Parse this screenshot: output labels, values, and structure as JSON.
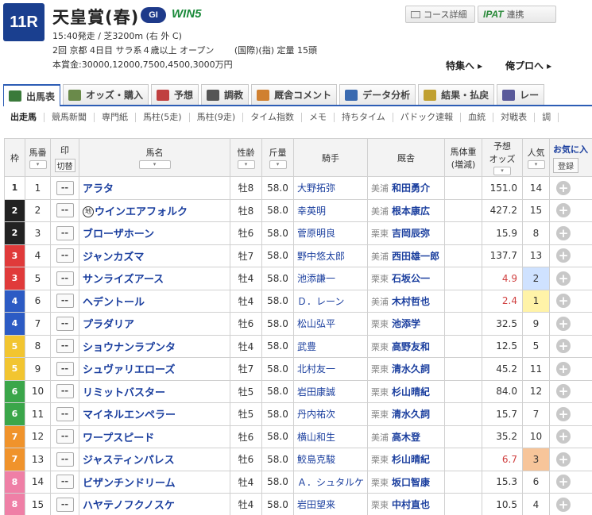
{
  "header": {
    "race_no": "11R",
    "race_name": "天皇賞(春)",
    "grade": "GI",
    "win5": "WIN5",
    "info1": "15:40発走 / 芝3200m (右 外 C)",
    "info2": "2回 京都 4日目 サラ系４歳以上 オープン 　　(国際)(指) 定量 15頭",
    "info3": "本賞金:30000,12000,7500,4500,3000万円",
    "course_detail": "コース詳細",
    "ipat_logo": "IPAT",
    "ipat_label": "連携",
    "tokushu": "特集へ ▸",
    "ore_pro": "俺プロへ ▸"
  },
  "tabs": [
    {
      "label": "出馬表",
      "icon": "table-icon",
      "active": true,
      "color": "#3a7a3a"
    },
    {
      "label": "オッズ・購入",
      "icon": "odds-icon",
      "active": false,
      "color": "#6a8a4a"
    },
    {
      "label": "予想",
      "icon": "target-icon",
      "active": false,
      "color": "#c04040"
    },
    {
      "label": "調教",
      "icon": "stopwatch-icon",
      "active": false,
      "color": "#555555"
    },
    {
      "label": "厩舎コメント",
      "icon": "stable-icon",
      "active": false,
      "color": "#d08030"
    },
    {
      "label": "データ分析",
      "icon": "bar-chart-icon",
      "active": false,
      "color": "#3a6ab0"
    },
    {
      "label": "結果・払戻",
      "icon": "coins-icon",
      "active": false,
      "color": "#c0a030"
    },
    {
      "label": "レー",
      "icon": "video-icon",
      "active": false,
      "color": "#5a5a9a"
    }
  ],
  "subnav": [
    "出走馬",
    "競馬新聞",
    "専門紙",
    "馬柱(5走)",
    "馬柱(9走)",
    "タイム指数",
    "メモ",
    "持ちタイム",
    "パドック速報",
    "血統",
    "対戦表",
    "調"
  ],
  "columns": {
    "waku": "枠",
    "umaban": "馬番",
    "mark": "印",
    "kirikae": "切替",
    "name": "馬名",
    "age": "性齢",
    "weight": "斤量",
    "jockey": "騎手",
    "trainer": "厩舎",
    "bw_line1": "馬体重",
    "bw_line2": "(増減)",
    "odds_line1": "予想",
    "odds_line2": "オッズ",
    "pop": "人気",
    "fav": "お気に入",
    "fav_reg": "登録",
    "sort_glyph": "▾"
  },
  "mark_value": "--",
  "add_glyph": "+",
  "waku_colors": {
    "1": {
      "bg": "#ffffff",
      "fg": "#333333"
    },
    "2": {
      "bg": "#222222",
      "fg": "#ffffff"
    },
    "3": {
      "bg": "#e03a3a",
      "fg": "#ffffff"
    },
    "4": {
      "bg": "#2c5bc4",
      "fg": "#ffffff"
    },
    "5": {
      "bg": "#f2c530",
      "fg": "#ffffff"
    },
    "6": {
      "bg": "#3aa64a",
      "fg": "#ffffff"
    },
    "7": {
      "bg": "#f0932b",
      "fg": "#ffffff"
    },
    "8": {
      "bg": "#ef7fa6",
      "fg": "#ffffff"
    }
  },
  "horses": [
    {
      "waku": "1",
      "umaban": "1",
      "name": "アラタ",
      "chi": "",
      "age": "牡8",
      "weight": "58.0",
      "jockey": "大野拓弥",
      "region": "美浦",
      "trainer": "和田勇介",
      "odds": "151.0",
      "odds_red": false,
      "pop": "14",
      "pop_class": ""
    },
    {
      "waku": "2",
      "umaban": "2",
      "name": "ウインエアフォルク",
      "chi": "地",
      "age": "牡8",
      "weight": "58.0",
      "jockey": "幸英明",
      "region": "美浦",
      "trainer": "根本康広",
      "odds": "427.2",
      "odds_red": false,
      "pop": "15",
      "pop_class": ""
    },
    {
      "waku": "2",
      "umaban": "3",
      "name": "ブローザホーン",
      "chi": "",
      "age": "牡6",
      "weight": "58.0",
      "jockey": "菅原明良",
      "region": "栗東",
      "trainer": "吉岡辰弥",
      "odds": "15.9",
      "odds_red": false,
      "pop": "8",
      "pop_class": ""
    },
    {
      "waku": "3",
      "umaban": "4",
      "name": "ジャンカズマ",
      "chi": "",
      "age": "牡7",
      "weight": "58.0",
      "jockey": "野中悠太郎",
      "region": "美浦",
      "trainer": "西田雄一郎",
      "odds": "137.7",
      "odds_red": false,
      "pop": "13",
      "pop_class": ""
    },
    {
      "waku": "3",
      "umaban": "5",
      "name": "サンライズアース",
      "chi": "",
      "age": "牡4",
      "weight": "58.0",
      "jockey": "池添謙一",
      "region": "栗東",
      "trainer": "石坂公一",
      "odds": "4.9",
      "odds_red": true,
      "pop": "2",
      "pop_class": "pop2"
    },
    {
      "waku": "4",
      "umaban": "6",
      "name": "ヘデントール",
      "chi": "",
      "age": "牡4",
      "weight": "58.0",
      "jockey": "Ｄ．レーン",
      "region": "美浦",
      "trainer": "木村哲也",
      "odds": "2.4",
      "odds_red": true,
      "pop": "1",
      "pop_class": "pop1"
    },
    {
      "waku": "4",
      "umaban": "7",
      "name": "プラダリア",
      "chi": "",
      "age": "牡6",
      "weight": "58.0",
      "jockey": "松山弘平",
      "region": "栗東",
      "trainer": "池添学",
      "odds": "32.5",
      "odds_red": false,
      "pop": "9",
      "pop_class": ""
    },
    {
      "waku": "5",
      "umaban": "8",
      "name": "ショウナンラプンタ",
      "chi": "",
      "age": "牡4",
      "weight": "58.0",
      "jockey": "武豊",
      "region": "栗東",
      "trainer": "高野友和",
      "odds": "12.5",
      "odds_red": false,
      "pop": "5",
      "pop_class": ""
    },
    {
      "waku": "5",
      "umaban": "9",
      "name": "シュヴァリエローズ",
      "chi": "",
      "age": "牡7",
      "weight": "58.0",
      "jockey": "北村友一",
      "region": "栗東",
      "trainer": "清水久詞",
      "odds": "45.2",
      "odds_red": false,
      "pop": "11",
      "pop_class": ""
    },
    {
      "waku": "6",
      "umaban": "10",
      "name": "リミットバスター",
      "chi": "",
      "age": "牡5",
      "weight": "58.0",
      "jockey": "岩田康誠",
      "region": "栗東",
      "trainer": "杉山晴紀",
      "odds": "84.0",
      "odds_red": false,
      "pop": "12",
      "pop_class": ""
    },
    {
      "waku": "6",
      "umaban": "11",
      "name": "マイネルエンペラー",
      "chi": "",
      "age": "牡5",
      "weight": "58.0",
      "jockey": "丹内祐次",
      "region": "栗東",
      "trainer": "清水久詞",
      "odds": "15.7",
      "odds_red": false,
      "pop": "7",
      "pop_class": ""
    },
    {
      "waku": "7",
      "umaban": "12",
      "name": "ワープスピード",
      "chi": "",
      "age": "牡6",
      "weight": "58.0",
      "jockey": "横山和生",
      "region": "美浦",
      "trainer": "高木登",
      "odds": "35.2",
      "odds_red": false,
      "pop": "10",
      "pop_class": ""
    },
    {
      "waku": "7",
      "umaban": "13",
      "name": "ジャスティンパレス",
      "chi": "",
      "age": "牡6",
      "weight": "58.0",
      "jockey": "鮫島克駿",
      "region": "栗東",
      "trainer": "杉山晴紀",
      "odds": "6.7",
      "odds_red": true,
      "pop": "3",
      "pop_class": "pop3"
    },
    {
      "waku": "8",
      "umaban": "14",
      "name": "ビザンチンドリーム",
      "chi": "",
      "age": "牡4",
      "weight": "58.0",
      "jockey": "Ａ．シュタルケ",
      "region": "栗東",
      "trainer": "坂口智康",
      "odds": "15.3",
      "odds_red": false,
      "pop": "6",
      "pop_class": ""
    },
    {
      "waku": "8",
      "umaban": "15",
      "name": "ハヤテノフクノスケ",
      "chi": "",
      "age": "牡4",
      "weight": "58.0",
      "jockey": "岩田望来",
      "region": "栗東",
      "trainer": "中村直也",
      "odds": "10.5",
      "odds_red": false,
      "pop": "4",
      "pop_class": ""
    }
  ]
}
